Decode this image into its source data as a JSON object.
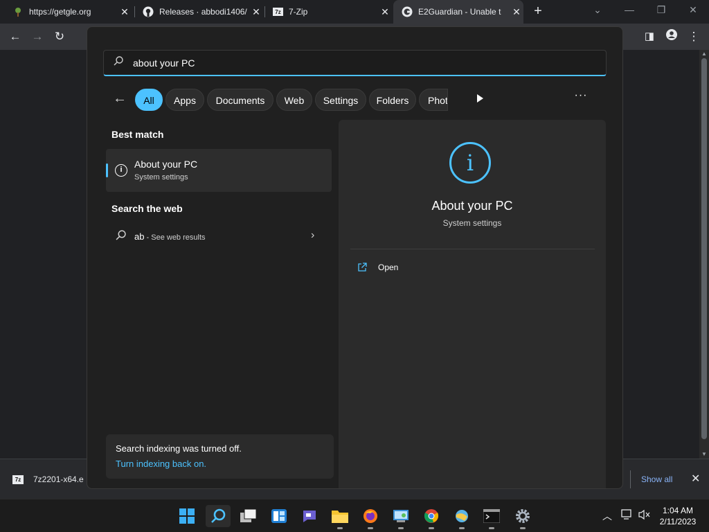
{
  "browser": {
    "tabs": [
      {
        "title": "https://getgle.org",
        "icon": "getgle-favicon"
      },
      {
        "title": "Releases · abbodi1406/",
        "icon": "github-icon"
      },
      {
        "title": "7-Zip",
        "icon": "7zip-icon"
      },
      {
        "title": "E2Guardian - Unable t",
        "icon": "google-icon"
      }
    ],
    "new_tab": "+",
    "tab_close": "✕",
    "download": {
      "filename": "7z2201-x64.e",
      "show_all": "Show all",
      "close": "✕"
    }
  },
  "search": {
    "query": "about your PC",
    "filters": [
      "All",
      "Apps",
      "Documents",
      "Web",
      "Settings",
      "Folders",
      "Phot"
    ],
    "best_match_header": "Best match",
    "best_match": {
      "title": "About your PC",
      "subtitle": "System settings"
    },
    "web_header": "Search the web",
    "web_result": {
      "term": "ab",
      "suffix": " - See web results"
    },
    "indexing": {
      "line1": "Search indexing was turned off.",
      "link": "Turn indexing back on."
    },
    "detail": {
      "title": "About your PC",
      "subtitle": "System settings",
      "action": "Open"
    }
  },
  "taskbar": {
    "time": "1:04 AM",
    "date": "2/11/2023"
  },
  "colors": {
    "accent": "#4cc2ff",
    "link": "#8ab4f8"
  }
}
